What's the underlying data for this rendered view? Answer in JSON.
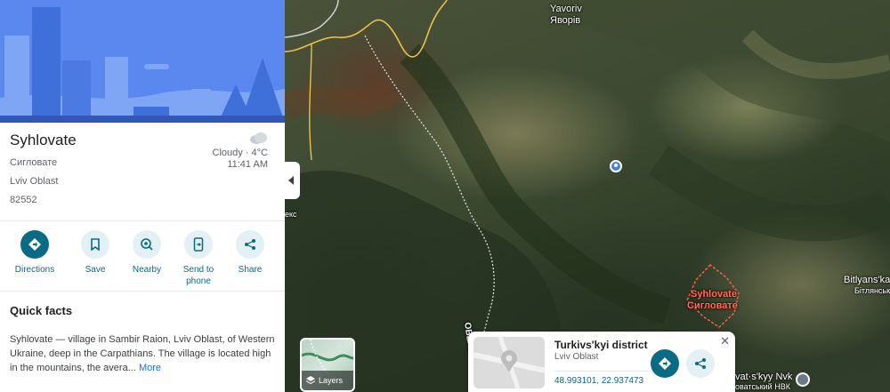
{
  "place": {
    "name": "Syhlovate",
    "native_name": "Сигловате",
    "region": "Lviv Oblast",
    "postal_code": "82552"
  },
  "weather": {
    "summary": "Cloudy · 4°C",
    "time": "11:41 AM",
    "icon": "cloud-icon"
  },
  "actions": [
    {
      "label": "Directions",
      "icon": "directions-icon"
    },
    {
      "label": "Save",
      "icon": "bookmark-icon"
    },
    {
      "label": "Nearby",
      "icon": "nearby-icon"
    },
    {
      "label": "Send to phone",
      "icon": "send-to-phone-icon"
    },
    {
      "label": "Share",
      "icon": "share-icon"
    }
  ],
  "quick_facts": {
    "title": "Quick facts",
    "text": "Syhlovate — village in Sambir Raion, Lviv Oblast, of Western Ukraine, deep in the Carpathians. The village is located high in the mountains, the avera...",
    "more": "More"
  },
  "map": {
    "labels": {
      "yavoriv_en": "Yavoriv",
      "yavoriv_ua": "Яворів",
      "syhlovate_en": "Syhlovate",
      "syhlovate_ua": "Сигловате",
      "bitlyanska_en": "Bitlyans'ka",
      "bitlyanska_ua": "Бітлянськ",
      "nvk_en": "vat·s'kyy Nvk",
      "nvk_ua": "оватський НВК",
      "oblast_road": "OBLAST",
      "eks": "екс"
    },
    "layers_label": "Layers"
  },
  "info_card": {
    "title": "Turkivs'kyi district",
    "subtitle": "Lviv Oblast",
    "coordinates": "48.993101, 22.937473"
  },
  "colors": {
    "accent": "#0b6a84",
    "hero": "#5a88ef",
    "boundary": "#ff6b5a"
  }
}
